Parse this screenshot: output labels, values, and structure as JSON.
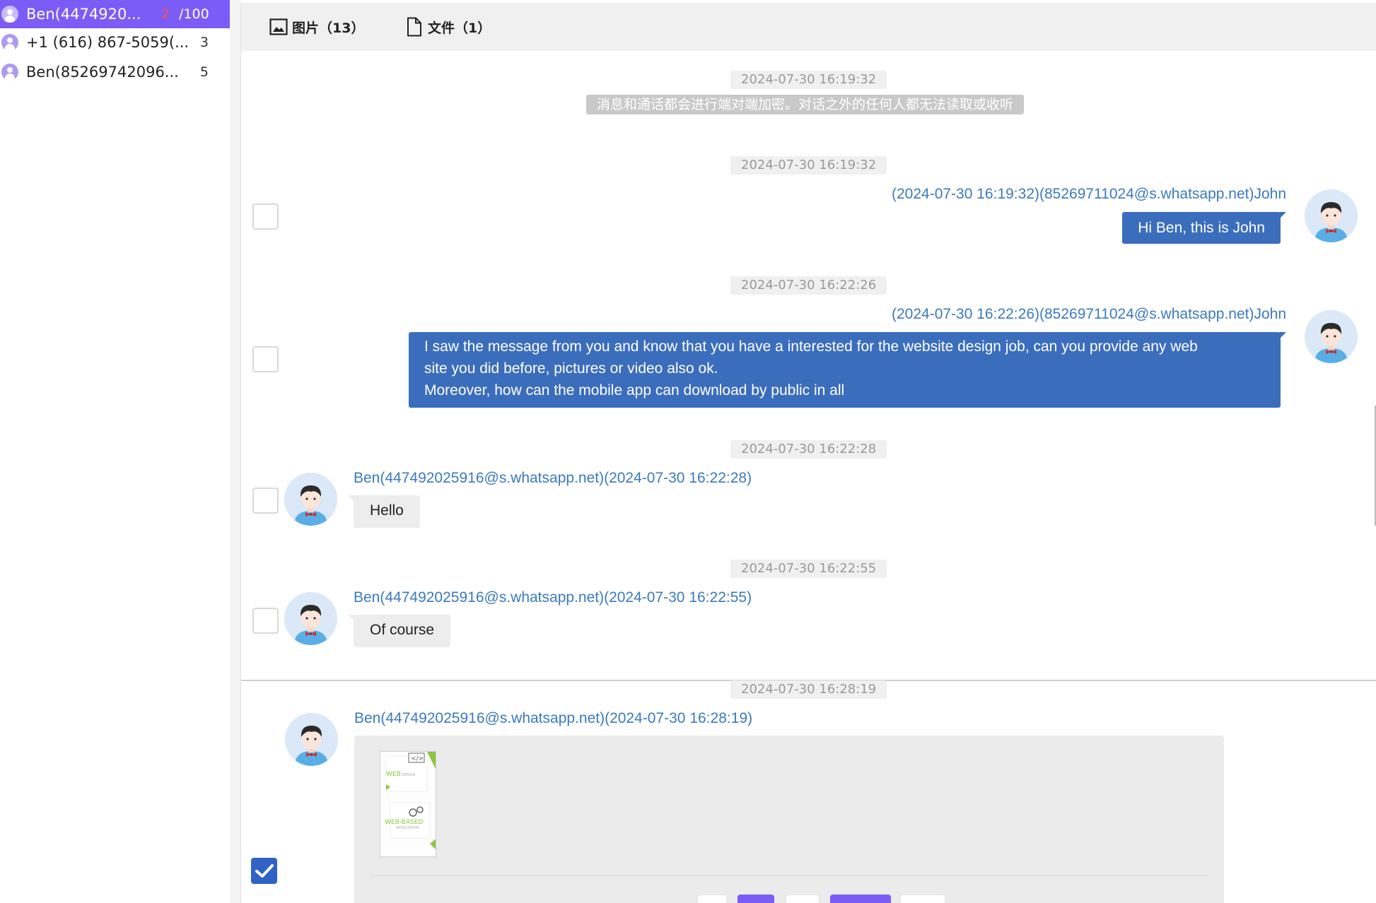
{
  "contacts": [
    {
      "name": "Ben(4474920...",
      "unread": "2",
      "limit": "/100",
      "active": true
    },
    {
      "name": "+1 (616) 867-5059(...",
      "count": "3"
    },
    {
      "name": "Ben(85269742096...",
      "count": "5"
    }
  ],
  "toolbar": {
    "images_label": "图片（13）",
    "files_label": "文件（1）"
  },
  "messages": {
    "t1": "2024-07-30 16:19:32",
    "system_notice": "消息和通话都会进行端对端加密。对话之外的任何人都无法读取或收听",
    "t2": "2024-07-30 16:19:32",
    "m1_sender": "(2024-07-30 16:19:32)(85269711024@s.whatsapp.net)John",
    "m1_text": "Hi Ben, this is John",
    "t3": "2024-07-30 16:22:26",
    "m2_sender": "(2024-07-30 16:22:26)(85269711024@s.whatsapp.net)John",
    "m2_line1": "I saw the message from you and know that you have a interested for the website design job, can you provide any web",
    "m2_line2": "site you did before, pictures or video also ok.",
    "m2_line3": "Moreover, how can the mobile app can download by public in all",
    "t4": "2024-07-30 16:22:28",
    "m3_sender": "Ben(447492025916@s.whatsapp.net)(2024-07-30 16:22:28)",
    "m3_text": "Hello",
    "t5": "2024-07-30 16:22:55",
    "m4_sender": "Ben(447492025916@s.whatsapp.net)(2024-07-30 16:22:55)",
    "m4_text": "Of course",
    "t6": "2024-07-30 16:28:19",
    "m5_sender": "Ben(447492025916@s.whatsapp.net)(2024-07-30 16:28:19)"
  },
  "thumbnail": {
    "line1": "WEB",
    "line1b": "DESIGN",
    "line2": "WEB-BASED",
    "line2b": "APPLICATION"
  },
  "colors": {
    "accent": "#7c5cf7",
    "outgoing_bubble": "#3b6dbd",
    "sender_link": "#3a7abf"
  },
  "selection": {
    "m1": false,
    "m2": false,
    "m3": false,
    "m4": false,
    "m5": true
  }
}
